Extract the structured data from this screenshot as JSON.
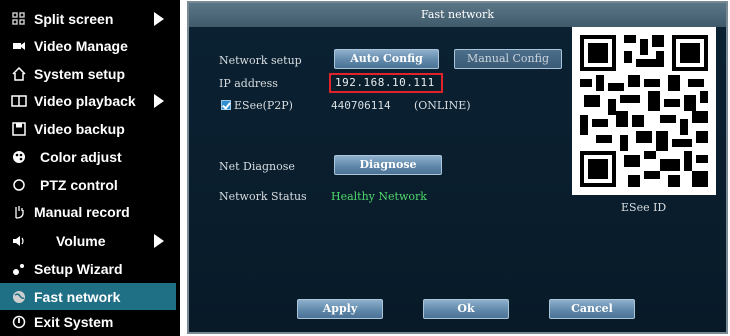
{
  "menu": {
    "items": [
      {
        "label": "Split screen",
        "icon": "grid-icon",
        "has_submenu": true
      },
      {
        "label": "Video Manage",
        "icon": "camera-icon",
        "has_submenu": false
      },
      {
        "label": "System setup",
        "icon": "home-icon",
        "has_submenu": false
      },
      {
        "label": "Video playback",
        "icon": "film-icon",
        "has_submenu": true
      },
      {
        "label": "Video backup",
        "icon": "floppy-icon",
        "has_submenu": false
      },
      {
        "label": "Color adjust",
        "icon": "palette-icon",
        "has_submenu": false
      },
      {
        "label": "PTZ control",
        "icon": "ptz-icon",
        "has_submenu": false
      },
      {
        "label": "Manual record",
        "icon": "hand-icon",
        "has_submenu": false
      },
      {
        "label": "Volume",
        "icon": "speaker-icon",
        "has_submenu": true
      },
      {
        "label": "Setup Wizard",
        "icon": "wizard-icon",
        "has_submenu": false
      },
      {
        "label": "Fast network",
        "icon": "globe-icon",
        "has_submenu": false,
        "selected": true
      },
      {
        "label": "Exit System",
        "icon": "power-icon",
        "has_submenu": false
      }
    ],
    "selected_color": "#1f6f85"
  },
  "dialog": {
    "title": "Fast network",
    "network_setup_label": "Network setup",
    "auto_config_label": "Auto Config",
    "manual_config_label": "Manual Config",
    "ip_label": "IP address",
    "ip_value": "192.168.10.111",
    "esee_label": "ESee(P2P)",
    "esee_checked": true,
    "esee_id": "440706114",
    "esee_status": "(ONLINE)",
    "net_diagnose_label": "Net Diagnose",
    "diagnose_button": "Diagnose",
    "network_status_label": "Network Status",
    "network_status_value": "Healthy Network",
    "qr_caption": "ESee ID",
    "apply_label": "Apply",
    "ok_label": "Ok",
    "cancel_label": "Cancel",
    "colors": {
      "status_ok": "#4fd86a",
      "highlight_border": "#e0232b"
    }
  }
}
